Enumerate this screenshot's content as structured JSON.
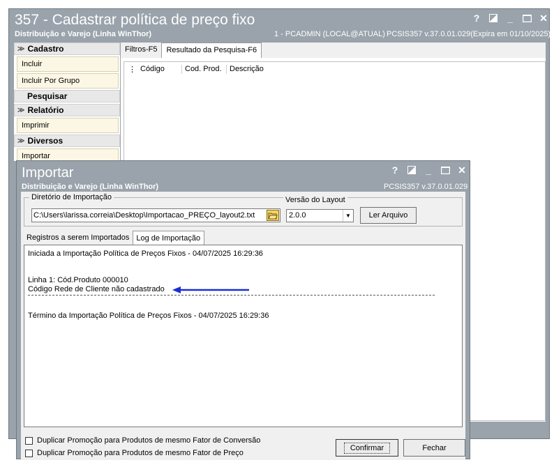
{
  "main_window": {
    "title": "357 - Cadastrar política de preço fixo",
    "subtitle": "Distribuição e Varejo (Linha WinThor)",
    "user_info": "1 - PCADMIN (LOCAL@ATUAL)",
    "version_info": "PCSIS357  v.37.0.01.029(Expira em 01/10/2025)",
    "controls": {
      "help": "?",
      "minimize": "_",
      "close": "✕"
    }
  },
  "sidebar": {
    "groups": [
      {
        "label": "Cadastro",
        "items": [
          "Incluir",
          "Incluir Por Grupo"
        ]
      },
      {
        "label": "Pesquisar",
        "items": []
      },
      {
        "label": "Relatório",
        "items": [
          "Imprimir"
        ]
      },
      {
        "label": "Diversos",
        "items": [
          "Importar"
        ]
      }
    ]
  },
  "main_tabs": [
    "Filtros-F5",
    "Resultado da Pesquisa-F6"
  ],
  "grid_columns": [
    "Código",
    "Cod. Prod.",
    "Descrição"
  ],
  "import_dialog": {
    "title": "Importar",
    "subtitle": "Distribuição e Varejo (Linha WinThor)",
    "version_info": "PCSIS357  v.37.0.01.029",
    "controls": {
      "help": "?",
      "minimize": "_",
      "close": "✕"
    },
    "dir_legend": "Diretório de Importação",
    "dir_value": "C:\\Users\\larissa.correia\\Desktop\\Importacao_PREÇO_layout2.txt",
    "layout_legend": "Versão do Layout",
    "layout_value": "2.0.0",
    "read_button": "Ler Arquivo",
    "tabs": [
      "Registros a serem Importados",
      "Log de Importação"
    ],
    "log": {
      "start": "Iniciada a Importação Política de Preços Fixos  -  04/07/2025 16:29:36",
      "line1": "Linha 1: Cód.Produto 000010",
      "line2": "Código Rede de Cliente não cadastrado",
      "end": "Término da Importação Política de Preços Fixos  -  04/07/2025 16:29:36"
    },
    "check1": "Duplicar Promoção para Produtos de mesmo Fator de Conversão",
    "check2": "Duplicar Promoção para Produtos de mesmo Fator de Preço",
    "confirm_button": "Confirmar",
    "close_button": "Fechar"
  },
  "colors": {
    "titlebar": "#9aa3ab",
    "annotation_arrow": "#1a2fd6"
  }
}
